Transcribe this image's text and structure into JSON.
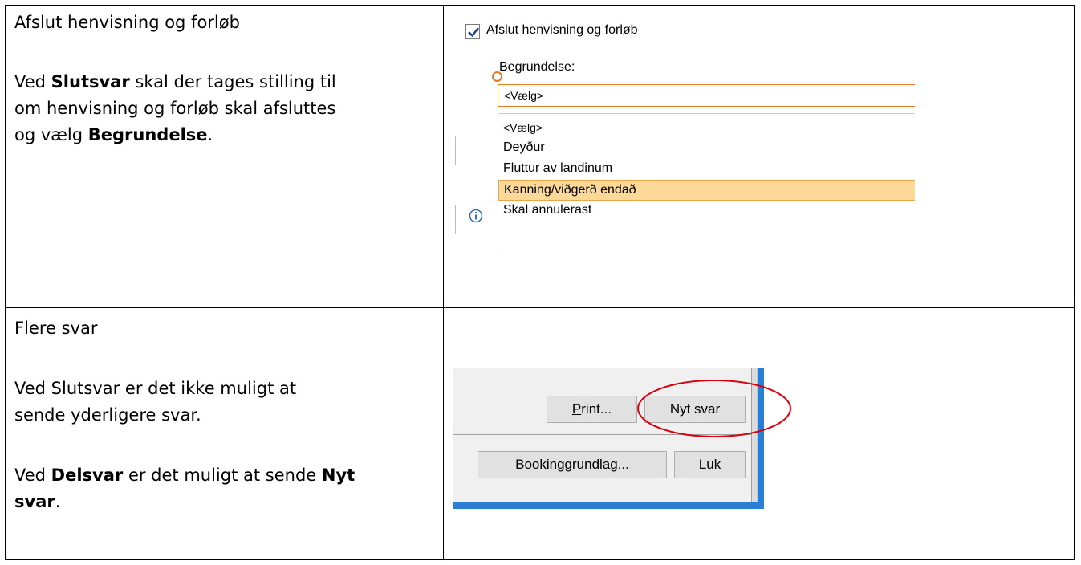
{
  "row1": {
    "title": "Afslut henvisning og forløb",
    "line1_pre": "Ved ",
    "line1_bold": "Slutsvar",
    "line1_post": " skal der tages stilling til",
    "line2": "om henvisning og forløb skal afsluttes",
    "line3_pre": "og vælg ",
    "line3_bold": "Begrundelse",
    "line3_post": ".",
    "screenshot": {
      "checkbox_label": "Afslut henvisning og forløb",
      "checkbox_checked": true,
      "reason_label": "Begrundelse:",
      "combo_value": "<Vælg>",
      "options": [
        "<Vælg>",
        "Deyður",
        "Fluttur av landinum",
        "Kanning/viðgerð endað",
        "Skal annulerast"
      ],
      "selected_option": "Kanning/viðgerð endað",
      "accent_color": "#e8791f",
      "highlight_color": "#fcd999"
    }
  },
  "row2": {
    "title": "Flere svar",
    "para1_line1": "Ved Slutsvar er det ikke muligt at",
    "para1_line2": "sende yderligere svar.",
    "para2_line1_pre": "Ved ",
    "para2_line1_bold1": "Delsvar",
    "para2_line1_mid": " er det muligt at sende ",
    "para2_line1_bold2": "Nyt",
    "para2_line2_bold": "svar",
    "para2_line2_post": ".",
    "screenshot": {
      "print_button_underlined": "P",
      "print_button_rest": "rint...",
      "new_reply_button": "Nyt svar",
      "booking_button": "Bookinggrundlag...",
      "close_button": "Luk",
      "circle_color": "#d9000d",
      "window_border_color": "#2a7fd2"
    }
  }
}
